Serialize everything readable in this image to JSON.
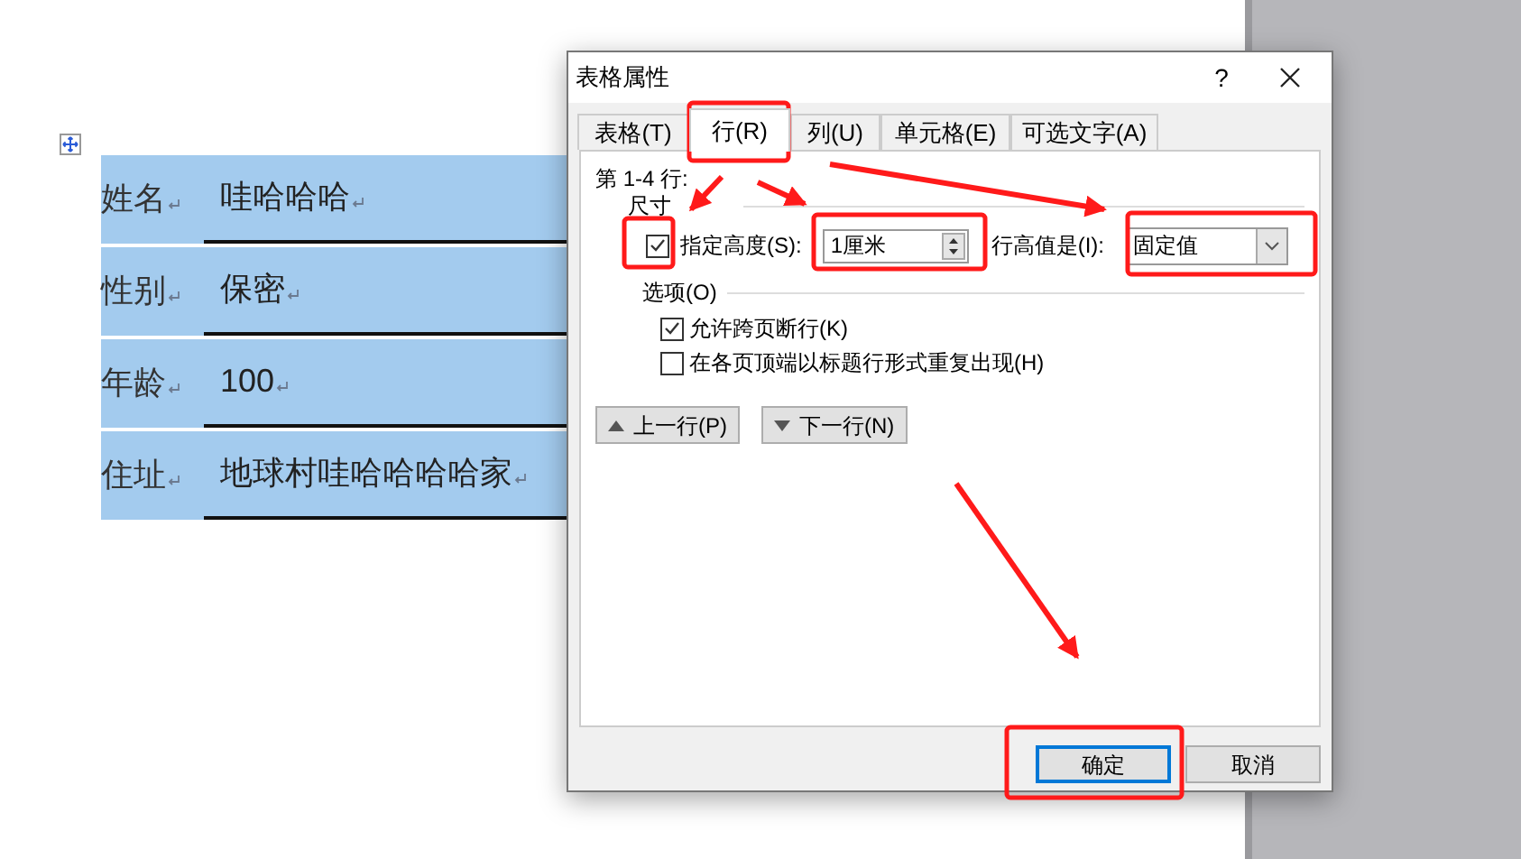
{
  "document": {
    "table": {
      "rows": [
        {
          "label": "姓名",
          "value": "哇哈哈哈"
        },
        {
          "label": "性别",
          "value": "保密"
        },
        {
          "label": "年龄",
          "value": "100"
        },
        {
          "label": "住址",
          "value": "地球村哇哈哈哈哈家"
        }
      ]
    }
  },
  "dialog": {
    "title": "表格属性",
    "help": "?",
    "tabs": [
      {
        "label": "表格(T)",
        "selected": false
      },
      {
        "label": "行(R)",
        "selected": true
      },
      {
        "label": "列(U)",
        "selected": false
      },
      {
        "label": "单元格(E)",
        "selected": false
      },
      {
        "label": "可选文字(A)",
        "selected": false
      }
    ],
    "rows_caption": "第 1-4 行:",
    "size_section": {
      "title": "尺寸",
      "specify_height": {
        "label": "指定高度(S):",
        "checked": true
      },
      "height_value": "1厘米",
      "row_height_label": "行高值是(I):",
      "row_height_mode": "固定值"
    },
    "options_section": {
      "title": "选项(O)",
      "options": [
        {
          "label": "允许跨页断行(K)",
          "checked": true
        },
        {
          "label": "在各页顶端以标题行形式重复出现(H)",
          "checked": false
        }
      ]
    },
    "nav_buttons": [
      {
        "label": "上一行(P)",
        "kind": "up"
      },
      {
        "label": "下一行(N)",
        "kind": "down"
      }
    ],
    "footer_buttons": [
      {
        "label": "确定",
        "focused": true
      },
      {
        "label": "取消",
        "focused": false
      }
    ]
  }
}
